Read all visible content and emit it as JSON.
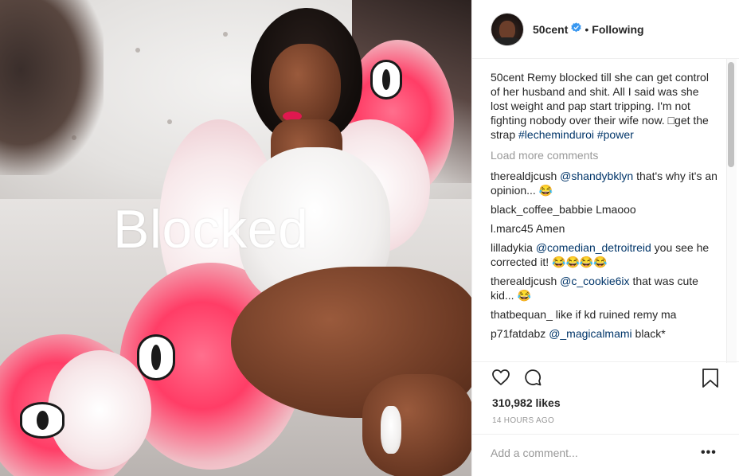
{
  "post": {
    "overlay_text": "Blocked"
  },
  "header": {
    "username": "50cent",
    "dot": "•",
    "follow_status": "Following",
    "verified_color": "#3897f0"
  },
  "caption": {
    "username": "50cent",
    "text": "Remy blocked till she can get control of her husband and shit. All I said was she lost weight and pap start tripping. I'm not fighting nobody over their wife now. □get the strap",
    "hashtag1": "#lecheminduroi",
    "hashtag2": "#power"
  },
  "load_more": "Load more comments",
  "comments": [
    {
      "user": "therealdjcush",
      "mention": "@shandybklyn",
      "text": "that's why it's an opinion... 😂"
    },
    {
      "user": "black_coffee_babbie",
      "mention": "",
      "text": "Lmaooo"
    },
    {
      "user": "l.marc45",
      "mention": "",
      "text": "Amen"
    },
    {
      "user": "lilladykia",
      "mention": "@comedian_detroitreid",
      "text": "you see he corrected it! 😂😂😂😂"
    },
    {
      "user": "therealdjcush",
      "mention": "@c_cookie6ix",
      "text": "that was cute kid... 😂"
    },
    {
      "user": "thatbequan_",
      "mention": "",
      "text": "like if kd ruined remy ma"
    },
    {
      "user": "p71fatdabz",
      "mention": "@_magicalmami",
      "text": "black*"
    }
  ],
  "likes": "310,982 likes",
  "timestamp": "14 HOURS AGO",
  "add_comment_placeholder": "Add a comment...",
  "more_options": "•••",
  "icons": {
    "like": "heart-icon",
    "comment": "comment-icon",
    "save": "bookmark-icon",
    "verified": "verified-badge-icon"
  }
}
